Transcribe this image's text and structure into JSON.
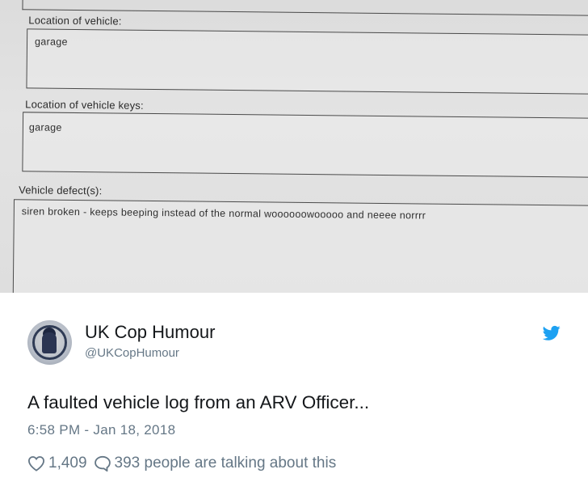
{
  "form": {
    "location_label": "Location of vehicle:",
    "location_value": "garage",
    "keys_label": "Location of vehicle keys:",
    "keys_value": "garage",
    "defects_label": "Vehicle defect(s):",
    "defects_value": "siren broken - keeps beeping instead of the normal woooooowooooo and neeee norrrr"
  },
  "tweet": {
    "display_name": "UK Cop Humour",
    "handle": "@UKCopHumour",
    "text": "A faulted vehicle log from an ARV Officer...",
    "timestamp": "6:58 PM - Jan 18, 2018",
    "like_count": "1,409",
    "talking_text": "393 people are talking about this",
    "icons": [
      "avatar",
      "twitter-bird-icon",
      "heart-icon",
      "speech-bubble-icon"
    ],
    "colors": {
      "twitter_blue": "#1DA1F2",
      "muted": "#657786",
      "text": "#14171A"
    }
  }
}
